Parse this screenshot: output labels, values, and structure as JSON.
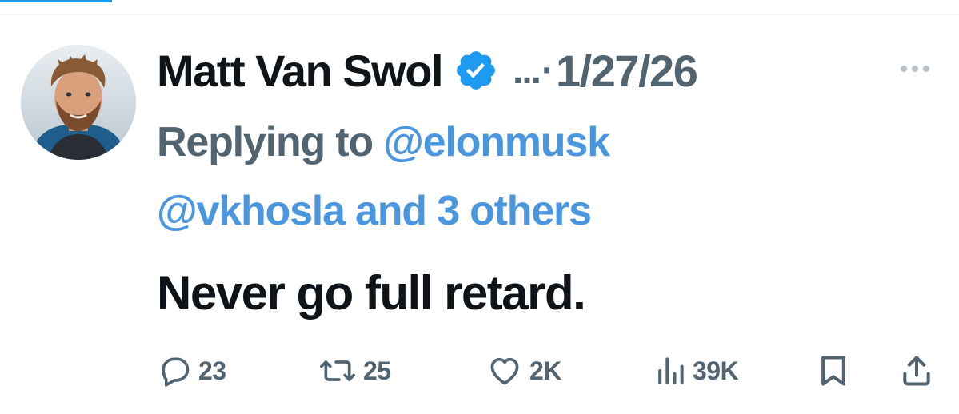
{
  "tweet": {
    "author": {
      "display_name": "Matt Van Swol",
      "verified": true,
      "handle_truncated": "...",
      "separator": "·",
      "avatar_icon": "avatar-photo"
    },
    "timestamp": "1/27/26",
    "replying_to": {
      "prefix": "Replying to",
      "mention_1": "@elonmusk",
      "mention_2": "@vkhosla",
      "others_text": "and 3 others"
    },
    "text": "Never go full retard."
  },
  "actions": {
    "reply_count": "23",
    "repost_count": "25",
    "like_count": "2K",
    "views_count": "39K",
    "icons": [
      "reply-icon",
      "repost-icon",
      "like-icon",
      "views-icon",
      "bookmark-icon",
      "share-icon"
    ]
  },
  "colors": {
    "name_text": "#0f1419",
    "muted_text": "#536471",
    "link_text": "#4a97e0",
    "verified_badge": "#1d9bf0",
    "icon_stroke": "#536471"
  }
}
